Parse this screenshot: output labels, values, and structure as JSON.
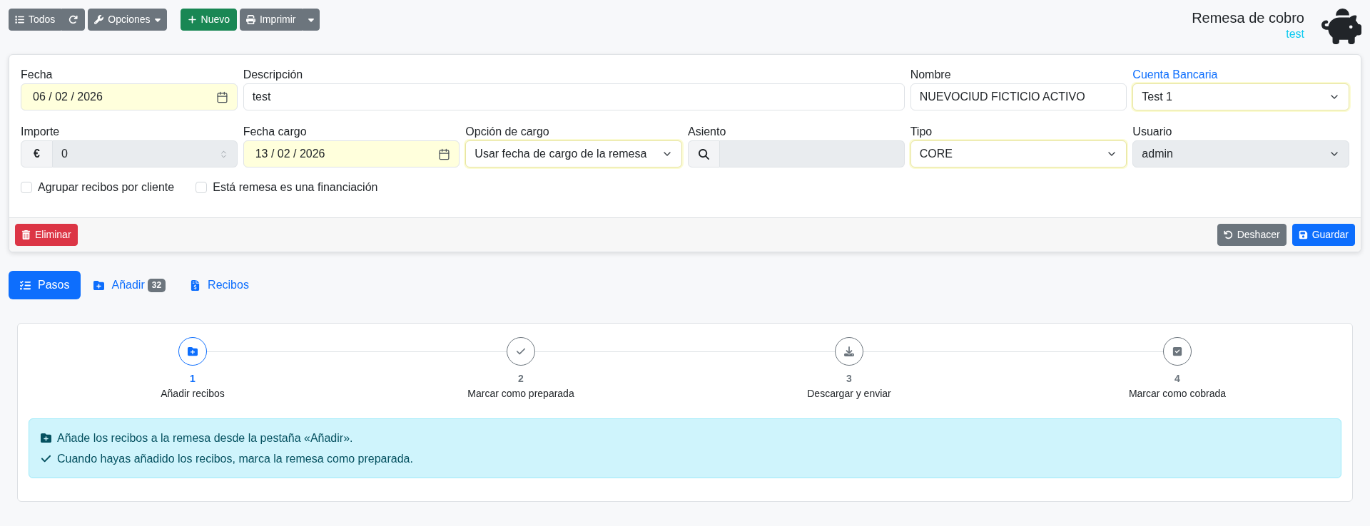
{
  "toolbar": {
    "groups": [
      [
        {
          "kind": "joined",
          "label": "Todos"
        },
        {
          "kind": "dropdown",
          "label": "Opciones"
        }
      ],
      [
        {
          "kind": "plain",
          "label": "Nuevo"
        },
        {
          "kind": "split",
          "label": "Imprimir"
        }
      ]
    ]
  },
  "header": {
    "title": "Remesa de cobro",
    "subtitle": "test"
  },
  "form": {
    "fields": [
      {
        "label": "Fecha",
        "kind": "date",
        "value": "06 / 02 / 2026",
        "required": true,
        "disabled": false,
        "link": false
      },
      {
        "label": "Descripción",
        "kind": "text",
        "value": "test",
        "required": false,
        "disabled": false,
        "link": false
      },
      {
        "label": "Nombre",
        "kind": "text",
        "value": "NUEVOCIUD FICTICIO ACTIVO",
        "required": false,
        "disabled": false,
        "link": false
      },
      {
        "label": "Cuenta Bancaria",
        "kind": "select",
        "value": "Test 1",
        "required": true,
        "disabled": false,
        "link": true
      },
      {
        "label": "Importe",
        "kind": "number",
        "prefix": "€",
        "value": "0",
        "required": false,
        "disabled": true,
        "link": false
      },
      {
        "label": "Fecha cargo",
        "kind": "date",
        "value": "13 / 02 / 2026",
        "required": true,
        "disabled": false,
        "link": false
      },
      {
        "label": "Opción de cargo",
        "kind": "select",
        "value": "Usar fecha de cargo de la remesa",
        "required": true,
        "disabled": false,
        "link": false
      },
      {
        "label": "Asiento",
        "kind": "search",
        "required": false,
        "disabled": true,
        "link": false
      },
      {
        "label": "Tipo",
        "kind": "select",
        "value": "CORE",
        "required": true,
        "disabled": false,
        "link": false
      },
      {
        "label": "Usuario",
        "kind": "select",
        "value": "admin",
        "required": false,
        "disabled": true,
        "link": false
      }
    ],
    "checkboxes": [
      {
        "label": "Agrupar recibos por cliente",
        "checked": false
      },
      {
        "label": "Está remesa es una financiación",
        "checked": false
      }
    ],
    "footer": {
      "left": [
        {
          "label": "Eliminar"
        }
      ],
      "right": [
        {
          "label": "Deshacer"
        },
        {
          "label": "Guardar"
        }
      ]
    }
  },
  "tabs": [
    {
      "label": "Pasos",
      "selected": true
    },
    {
      "label": "Añadir",
      "badge": "32",
      "selected": false
    },
    {
      "label": "Recibos",
      "selected": false
    }
  ],
  "steps": [
    {
      "number": "1",
      "label": "Añadir recibos",
      "active": true
    },
    {
      "number": "2",
      "label": "Marcar como preparada",
      "active": false
    },
    {
      "number": "3",
      "label": "Descargar y enviar",
      "active": false
    },
    {
      "number": "4",
      "label": "Marcar como cobrada",
      "active": false
    }
  ],
  "alert": {
    "lines": [
      "Añade los recibos a la remesa desde la pestaña «Añadir».",
      "Cuando hayas añadido los recibos, marca la remesa como preparada."
    ]
  }
}
